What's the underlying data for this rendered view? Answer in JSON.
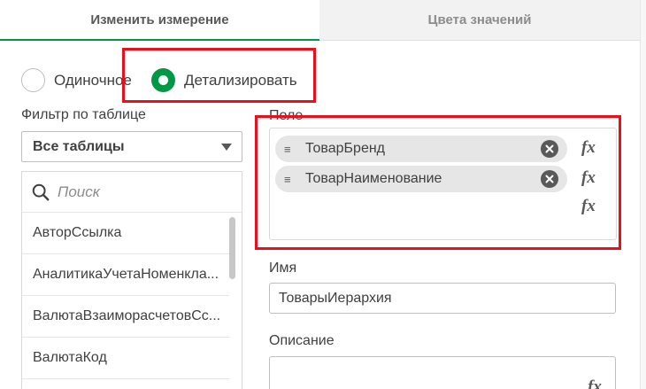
{
  "tabs": {
    "active": "Изменить измерение",
    "inactive": "Цвета значений"
  },
  "dimension_type": {
    "single": "Одиночное",
    "drilldown": "Детализировать",
    "selected": "drilldown"
  },
  "filter": {
    "label": "Фильтр по таблице",
    "selected": "Все таблицы"
  },
  "search": {
    "placeholder": "Поиск"
  },
  "field_list": [
    "АвторСсылка",
    "АналитикаУчетаНоменкла...",
    "ВалютаВзаиморасчетовСс...",
    "ВалютаКод"
  ],
  "fields": {
    "label": "Поле",
    "items": [
      "ТоварБренд",
      "ТоварНаименование"
    ],
    "fx_label": "fx"
  },
  "name": {
    "label": "Имя",
    "value": "ТоварыИерархия"
  },
  "description": {
    "label": "Описание",
    "value": ""
  },
  "colors": {
    "accent": "#009845",
    "highlight": "#e8101a",
    "chip": "#e6e6e6"
  }
}
